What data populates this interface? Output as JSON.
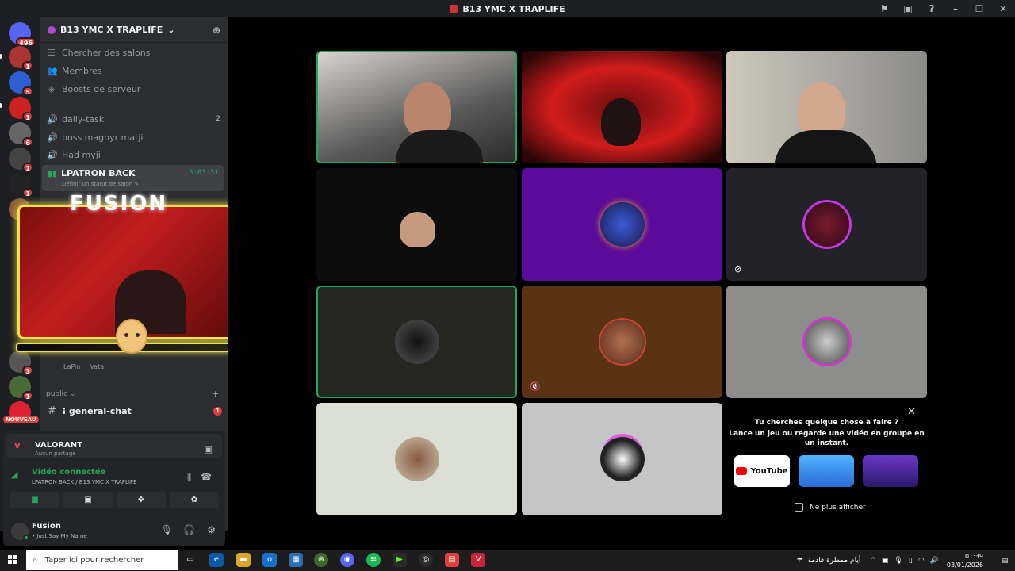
{
  "window": {
    "title": "B13 YMC X TRAPLIFE"
  },
  "servers": {
    "home_badge": "496",
    "badges": [
      "1",
      "5",
      "1",
      "6",
      "1",
      "1",
      "1",
      "3",
      "1"
    ],
    "new_label": "NOUVEAU"
  },
  "guild": {
    "name": "B13 YMC X TRAPLIFE",
    "nav": [
      {
        "label": "Chercher des salons",
        "icon": "☰"
      },
      {
        "label": "Membres",
        "icon": "👥"
      },
      {
        "label": "Boosts de serveur",
        "icon": "◈"
      }
    ],
    "channels": [
      {
        "label": "daily-task",
        "count": "2"
      },
      {
        "label": "boss maghyr matji",
        "count": ""
      },
      {
        "label": "Had myji",
        "count": ""
      }
    ],
    "active_voice": {
      "name": "LPATRON BACK",
      "timer": "3:03:31",
      "status": "Définir un statut de salon ✎"
    },
    "overlay_brand": "FUSION",
    "overlay_users": [
      "LaPin",
      "Vata"
    ],
    "category": "public ⌄",
    "text_channel": {
      "name": "⁝ general-chat",
      "badge": "1"
    }
  },
  "panel": {
    "activity": {
      "game": "VALORANT",
      "share": "Aucun partage"
    },
    "voice": {
      "label": "Vidéo connectée",
      "location": "LPATRON BACK / B13 YMC X TRAPLIFE"
    },
    "user": {
      "name": "Fusion",
      "status": "• Just Say My Name"
    }
  },
  "suggestion": {
    "line1": "Tu cherches quelque chose à faire ?",
    "line2": "Lance un jeu ou regarde une vidéo en groupe en un instant.",
    "youtube": "YouTube",
    "hide": "Ne plus afficher"
  },
  "taskbar": {
    "search_placeholder": "Taper ici pour rechercher",
    "weather": "أيام ممطرة قادمة",
    "time": "01:39",
    "date": "03/01/2026"
  },
  "colors": {
    "accent_green": "#23a55a",
    "overlay_yellow": "#f3e34a",
    "badge_red": "#e23c3c"
  }
}
